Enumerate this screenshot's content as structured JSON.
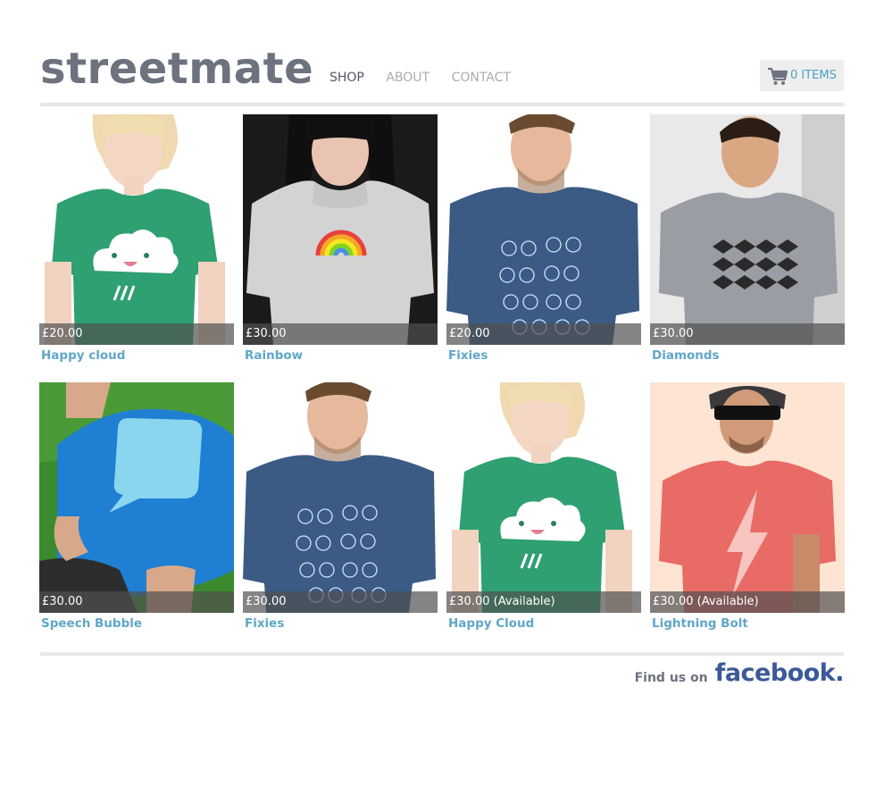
{
  "header": {
    "logo": "streetmate",
    "nav": [
      "SHOP",
      "ABOUT",
      "CONTACT"
    ],
    "cart_label": "0 ITEMS"
  },
  "products": [
    {
      "name": "Happy cloud",
      "price": "£20.00"
    },
    {
      "name": "Rainbow",
      "price": "£30.00"
    },
    {
      "name": "Fixies",
      "price": "£20.00"
    },
    {
      "name": "Diamonds",
      "price": "£30.00"
    },
    {
      "name": "Speech Bubble",
      "price": "£30.00"
    },
    {
      "name": "Fixies",
      "price": "£30.00"
    },
    {
      "name": "Happy Cloud",
      "price": "£30.00 (Available)"
    },
    {
      "name": "Lightning Bolt",
      "price": "£30.00 (Available)"
    }
  ],
  "footer": {
    "find_us": "Find us on",
    "facebook": "facebook."
  },
  "colors": {
    "logo": "#6d727f",
    "link": "#5fa7c8",
    "cart_text": "#4ea2c5",
    "facebook": "#3b5998"
  }
}
